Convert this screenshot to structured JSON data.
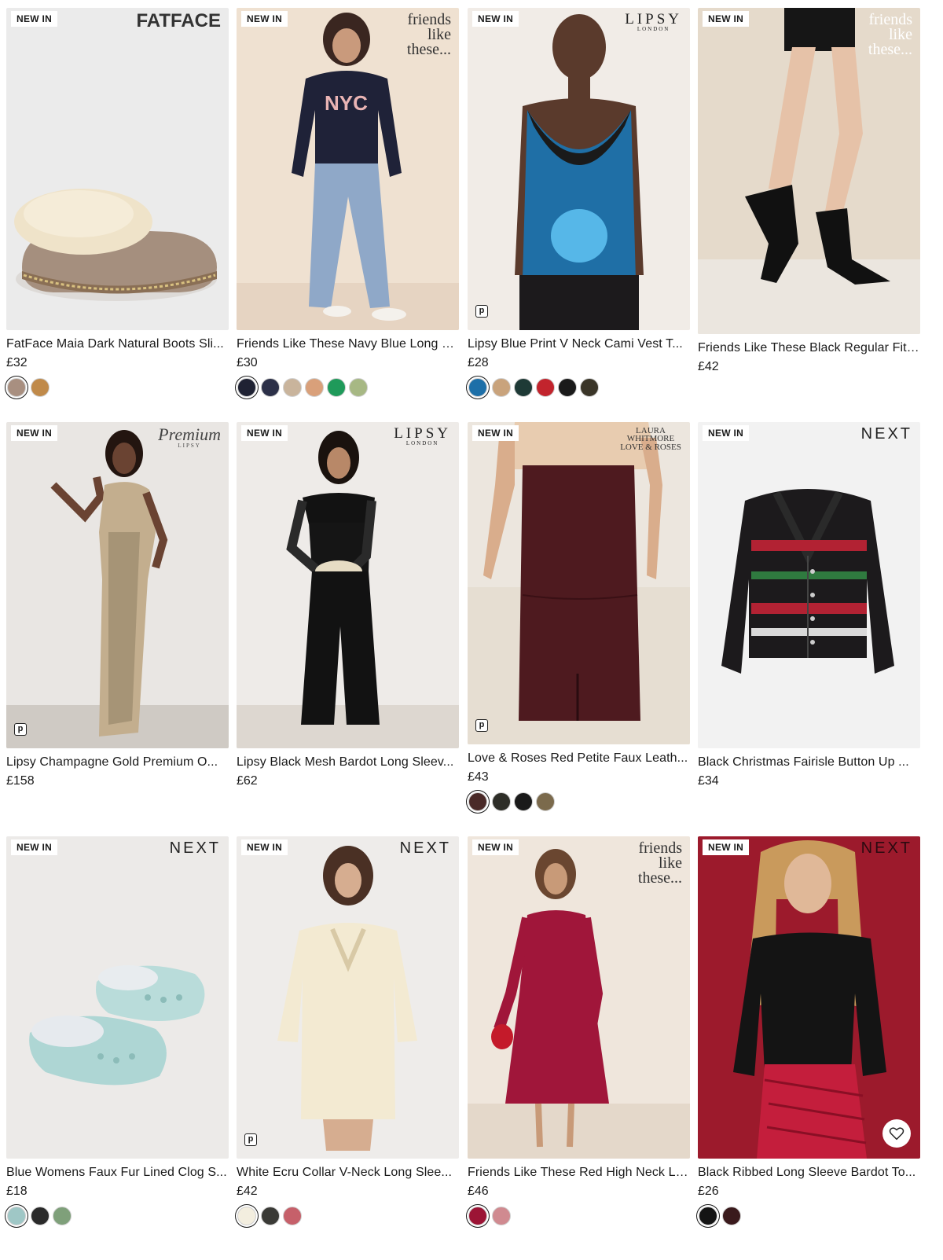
{
  "products": [
    {
      "badge": "NEW IN",
      "brand": "FATFACE",
      "title": "FatFace Maia Dark Natural Boots Sli...",
      "price": "£32",
      "bg": "#eaeaea",
      "swatches": [
        "#a88f80",
        "#c08a4a"
      ]
    },
    {
      "badge": "NEW IN",
      "brand": "friends like these...",
      "title": "Friends Like These Navy Blue Long S...",
      "price": "£30",
      "bg": "#efe0d0",
      "swatches": [
        "#1f2233",
        "#2c3048",
        "#c9b49c",
        "#d9a07a",
        "#1f9a5a",
        "#a7b884"
      ]
    },
    {
      "badge": "NEW IN",
      "brand": "LIPSY",
      "brand_sub": "LONDON",
      "title": "Lipsy Blue Print V Neck Cami Vest T...",
      "price": "£28",
      "bg": "#f1ece7",
      "swatches": [
        "#1d6fa8",
        "#c9a37c",
        "#1e3a36",
        "#c2242d",
        "#1a1a1a",
        "#3a3528"
      ]
    },
    {
      "badge": "NEW IN",
      "brand": "friends like these...",
      "title": "Friends Like These Black Regular Fit ...",
      "price": "£42",
      "bg": "#e7dccd",
      "swatches": []
    },
    {
      "badge": "NEW IN",
      "brand": "Premium",
      "brand_sub": "LIPSY",
      "title": "Lipsy Champagne Gold Premium O...",
      "price": "£158",
      "bg": "#e9e6e3",
      "swatches": []
    },
    {
      "badge": "NEW IN",
      "brand": "LIPSY",
      "brand_sub": "LONDON",
      "title": "Lipsy Black Mesh Bardot Long Sleev...",
      "price": "£62",
      "bg": "#efecea",
      "swatches": []
    },
    {
      "badge": "NEW IN",
      "brand": "LAURA WHITMORE LOVE & ROSES",
      "title": "Love & Roses Red Petite Faux Leath...",
      "price": "£43",
      "bg": "#ece7df",
      "swatches": [
        "#4a2a28",
        "#2e2e28",
        "#1a1a1a",
        "#7b6a4c"
      ]
    },
    {
      "badge": "NEW IN",
      "brand": "NEXT",
      "title": "Black Christmas Fairisle Button Up ...",
      "price": "£34",
      "bg": "#f2f2f2",
      "swatches": []
    },
    {
      "badge": "NEW IN",
      "brand": "NEXT",
      "title": "Blue Womens Faux Fur Lined Clog S...",
      "price": "£18",
      "bg": "#eceae8",
      "swatches": [
        "#9fc7c6",
        "#2a2a2a",
        "#7fa07a"
      ]
    },
    {
      "badge": "NEW IN",
      "brand": "NEXT",
      "title": "White Ecru Collar V-Neck Long Slee...",
      "price": "£42",
      "bg": "#eeeceb",
      "swatches": [
        "#f3eedf",
        "#3a3a36",
        "#c6606a"
      ]
    },
    {
      "badge": "NEW IN",
      "brand": "friends like these...",
      "title": "Friends Like These Red High Neck Lo...",
      "price": "£46",
      "bg": "#efe6dc",
      "swatches": [
        "#9c1435",
        "#d08a90"
      ]
    },
    {
      "badge": "NEW IN",
      "brand": "NEXT",
      "title": "Black Ribbed Long Sleeve Bardot To...",
      "price": "£26",
      "bg": "#9c1a2c",
      "swatches": [
        "#141414",
        "#3a1a1c"
      ]
    }
  ],
  "icons": {
    "pay": "p",
    "wishlist": "heart-outline-icon"
  },
  "colors": {
    "text": "#1a1a1a",
    "badge_bg": "#ffffff"
  }
}
